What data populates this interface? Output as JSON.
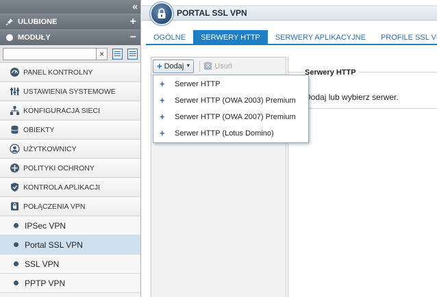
{
  "sidebar": {
    "collapse_glyph": "«",
    "favorites": {
      "label": "ULUBIONE",
      "action": "+"
    },
    "modules": {
      "label": "MODUŁY",
      "action": "−"
    },
    "search": {
      "value": "",
      "placeholder": "",
      "clear_glyph": "×"
    },
    "nav_items": [
      {
        "label": "PANEL KONTROLNY",
        "icon": "dashboard-icon"
      },
      {
        "label": "USTAWIENIA SYSTEMOWE",
        "icon": "system-settings-icon"
      },
      {
        "label": "KONFIGURACJA SIECI",
        "icon": "network-icon"
      },
      {
        "label": "OBIEKTY",
        "icon": "database-icon"
      },
      {
        "label": "UŻYTKOWNICY",
        "icon": "user-icon"
      },
      {
        "label": "POLITYKI OCHRONY",
        "icon": "policy-icon"
      },
      {
        "label": "KONTROLA APLIKACJI",
        "icon": "shield-icon"
      },
      {
        "label": "POŁĄCZENIA VPN",
        "icon": "vpn-icon"
      }
    ],
    "sub_items": [
      {
        "label": "IPSec VPN"
      },
      {
        "label": "Portal SSL VPN"
      },
      {
        "label": "SSL VPN"
      },
      {
        "label": "PPTP VPN"
      }
    ]
  },
  "page": {
    "title": "PORTAL SSL VPN",
    "title_icon": "lock-icon",
    "tabs": [
      {
        "label": "OGÓLNE"
      },
      {
        "label": "SERWERY HTTP"
      },
      {
        "label": "SERWERY APLIKACYJNE"
      },
      {
        "label": "PROFILE SSL VPN"
      }
    ],
    "active_tab": "SERWERY HTTP"
  },
  "toolbar": {
    "add_label": "Dodaj",
    "delete_label": "Usuń"
  },
  "dropdown": {
    "items": [
      {
        "label": "Serwer HTTP"
      },
      {
        "label": "Serwer HTTP (OWA 2003) Premium"
      },
      {
        "label": "Serwer HTTP (OWA 2007) Premium"
      },
      {
        "label": "Serwer HTTP (Lotus Domino)"
      }
    ]
  },
  "detail": {
    "title": "Serwery HTTP",
    "message": "Dodaj lub wybierz serwer."
  },
  "colors": {
    "accent": "#1f7fc4",
    "sidebar_header": "#6a727b",
    "active_item": "#cfe0ef"
  }
}
